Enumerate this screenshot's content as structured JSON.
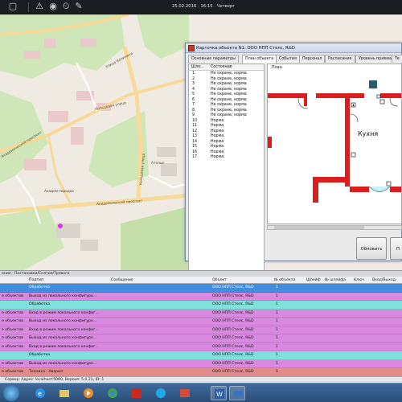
{
  "toolbar": {
    "datetime": "25.02.2016 · 16:15 · Четверг",
    "icons": [
      "restore-icon",
      "warning-icon",
      "fire-icon",
      "alarm-clock-icon",
      "wrench-icon"
    ]
  },
  "map": {
    "labels": {
      "kalinina": "Улица Калинина",
      "kolnichnaya": "Кольцевая улица",
      "kolnichnaya_v": "Кольцевая улица",
      "akademicheskiy": "Академический проспект",
      "akademicheskiy2": "Академический проспект",
      "akademgorodok": "Академ-городок",
      "atelie": "Ателье"
    },
    "colors": {
      "land": "#f0ebe2",
      "park": "#cfe6b8",
      "residential": "#e9c9c9",
      "road": "#f7d99a"
    }
  },
  "dialog": {
    "title": "Карточка объекта N1: ООО НПП Стелс, R&D",
    "tabs": [
      "Основные параметры",
      "План объекта",
      "События",
      "Персонал",
      "Расписание",
      "Уровень приема",
      "Те"
    ],
    "active_tab": "План объекта",
    "zones_header": {
      "num": "Шле...",
      "state": "Состояние"
    },
    "zones": [
      {
        "num": "1",
        "state": "Не охране, норма"
      },
      {
        "num": "2",
        "state": "Не охране, норма"
      },
      {
        "num": "3",
        "state": "Не охране, норма"
      },
      {
        "num": "4",
        "state": "Не охране, норма"
      },
      {
        "num": "5",
        "state": "Не охране, норма"
      },
      {
        "num": "6",
        "state": "Не охране, норма"
      },
      {
        "num": "7",
        "state": "Не охране, норма"
      },
      {
        "num": "8",
        "state": "Не охране, норма"
      },
      {
        "num": "9",
        "state": "Не охране, норма"
      },
      {
        "num": "10",
        "state": "Норма"
      },
      {
        "num": "11",
        "state": "Норма"
      },
      {
        "num": "12",
        "state": "Норма"
      },
      {
        "num": "13",
        "state": "Норма"
      },
      {
        "num": "14",
        "state": "Норма"
      },
      {
        "num": "15",
        "state": "Норма"
      },
      {
        "num": "16",
        "state": "Норма"
      },
      {
        "num": "17",
        "state": "Норма"
      }
    ],
    "plan_label": "План",
    "room_label": "Кухня",
    "refresh_button": "Обновить",
    "second_button": "П"
  },
  "events": {
    "strip": "ания · Постановки/Снятия/Тревоги",
    "headers": {
      "sub": "Подтип",
      "msg": "Сообщение",
      "obj": "Объект",
      "num": "№ объекта",
      "loop": "Шлейф",
      "loopnum": "№ шлейфа",
      "key": "Ключ",
      "io": "Вход/Выход"
    },
    "rows": [
      {
        "type": "",
        "sub": "Обработка",
        "obj": "ООО НПП Стелс, R&D",
        "num": "1",
        "color": "#3f8ee0",
        "text_color": "#ffffff"
      },
      {
        "type": "е объектов",
        "sub": "Выход из локального конфигуро...",
        "obj": "ООО НПП Стелс, R&D",
        "num": "1",
        "color": "#d98ae0",
        "text_color": "#111111"
      },
      {
        "type": "",
        "sub": "Обработка",
        "obj": "ООО НПП Стелс, R&D",
        "num": "1",
        "color": "#7fe1dc",
        "text_color": "#111111"
      },
      {
        "type": "е объектов",
        "sub": "Вход в режим локального конфиг...",
        "obj": "ООО НПП Стелс, R&D",
        "num": "1",
        "color": "#d98ae0",
        "text_color": "#111111"
      },
      {
        "type": "е объектов",
        "sub": "Выход из локального конфигуро...",
        "obj": "ООО НПП Стелс, R&D",
        "num": "1",
        "color": "#d98ae0",
        "text_color": "#111111"
      },
      {
        "type": "е объектов",
        "sub": "Вход в режим локального конфиг...",
        "obj": "ООО НПП Стелс, R&D",
        "num": "1",
        "color": "#d98ae0",
        "text_color": "#111111"
      },
      {
        "type": "е объектов",
        "sub": "Выход из локального конфигуро...",
        "obj": "ООО НПП Стелс, R&D",
        "num": "1",
        "color": "#d98ae0",
        "text_color": "#111111"
      },
      {
        "type": "е объектов",
        "sub": "Вход в режим локального конфиг...",
        "obj": "ООО НПП Стелс, R&D",
        "num": "1",
        "color": "#d98ae0",
        "text_color": "#111111"
      },
      {
        "type": "",
        "sub": "Обработка",
        "obj": "ООО НПП Стелс, R&D",
        "num": "1",
        "color": "#7fe1dc",
        "text_color": "#111111"
      },
      {
        "type": "е объектов",
        "sub": "Выход из локального конфигуро...",
        "obj": "ООО НПП Стелс, R&D",
        "num": "1",
        "color": "#d98ae0",
        "text_color": "#111111"
      },
      {
        "type": "е объектов",
        "sub": "Техника - Авария",
        "obj": "ООО НПП Стелс, R&D",
        "num": "1",
        "color": "#e58a8a",
        "text_color": "#111111"
      }
    ]
  },
  "statusbar": {
    "text": "Сервер: Адрес: localhost:5080, Версия: 5.0.21, ID: 1"
  },
  "taskbar": {
    "apps": [
      "windows-start-icon",
      "internet-explorer-icon",
      "file-explorer-icon",
      "media-player-icon",
      "chrome-icon",
      "acrobat-icon",
      "skype-icon",
      "word-icon",
      "app-icon"
    ]
  }
}
